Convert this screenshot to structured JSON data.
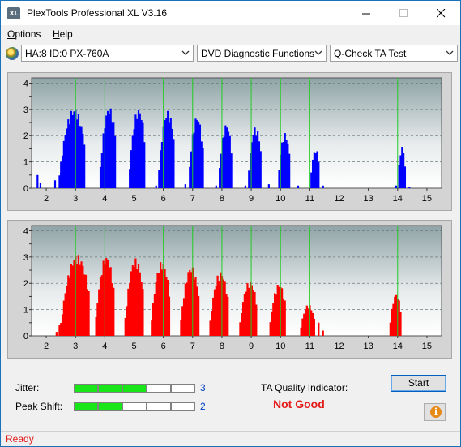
{
  "window": {
    "title": "PlexTools Professional XL V3.16",
    "app_icon_text": "XL"
  },
  "menu": {
    "options_label": "Options",
    "options_hotkey": "O",
    "options_rest": "ptions",
    "help_label": "Help",
    "help_hotkey": "H",
    "help_rest": "elp"
  },
  "toolbar": {
    "drive": "HA:8 ID:0  PX-760A",
    "function": "DVD Diagnostic Functions",
    "test": "Q-Check TA Test"
  },
  "colors": {
    "top_bars": "#0000ff",
    "bottom_bars": "#ff0000",
    "markers": "#22cc22",
    "meter_on": "#19e619",
    "status": "#e21b1b"
  },
  "chart_data": [
    {
      "type": "bar",
      "x_ticks": [
        2,
        3,
        4,
        5,
        6,
        7,
        8,
        9,
        10,
        11,
        12,
        13,
        14,
        15
      ],
      "y_ticks": [
        "0",
        "0.5",
        "1",
        "1.5",
        "2",
        "2.5",
        "3",
        "3.5",
        "4"
      ],
      "xlim": [
        1.5,
        15.5
      ],
      "ylim": [
        0,
        4.2
      ],
      "markers": [
        3,
        4,
        5,
        6,
        7,
        8,
        9,
        10,
        11,
        14
      ],
      "groups": [
        {
          "center": 2.95,
          "peak": 3.05,
          "half_width": 0.55
        },
        {
          "center": 4.15,
          "peak": 3.1,
          "half_width": 0.35
        },
        {
          "center": 5.15,
          "peak": 3.05,
          "half_width": 0.35
        },
        {
          "center": 6.15,
          "peak": 2.95,
          "half_width": 0.35
        },
        {
          "center": 7.15,
          "peak": 2.75,
          "half_width": 0.3
        },
        {
          "center": 8.15,
          "peak": 2.45,
          "half_width": 0.28
        },
        {
          "center": 9.15,
          "peak": 2.35,
          "half_width": 0.28
        },
        {
          "center": 10.15,
          "peak": 2.1,
          "half_width": 0.25
        },
        {
          "center": 11.2,
          "peak": 1.5,
          "half_width": 0.2
        },
        {
          "center": 14.15,
          "peak": 1.6,
          "half_width": 0.15
        }
      ],
      "noise_x": [
        1.7,
        1.8,
        2.3,
        2.5,
        5.75,
        6.75,
        7.8,
        8.8,
        9.6,
        10.6,
        11.45,
        13.95,
        14.4
      ],
      "noise_y": [
        0.5,
        0.2,
        0.3,
        0.6,
        0.1,
        0.15,
        0.1,
        0.1,
        0.15,
        0.1,
        0.1,
        0.1,
        0.05
      ]
    },
    {
      "type": "bar",
      "x_ticks": [
        2,
        3,
        4,
        5,
        6,
        7,
        8,
        9,
        10,
        11,
        12,
        13,
        14,
        15
      ],
      "y_ticks": [
        "0",
        "0.5",
        "1",
        "1.5",
        "2",
        "2.5",
        "3",
        "3.5",
        "4"
      ],
      "xlim": [
        1.5,
        15.5
      ],
      "ylim": [
        0,
        4.2
      ],
      "markers": [
        3,
        4,
        5,
        6,
        7,
        8,
        9,
        10,
        11,
        14
      ],
      "groups": [
        {
          "center": 3.05,
          "peak": 3.1,
          "half_width": 0.6
        },
        {
          "center": 4.05,
          "peak": 3.05,
          "half_width": 0.4
        },
        {
          "center": 5.05,
          "peak": 2.95,
          "half_width": 0.4
        },
        {
          "center": 5.95,
          "peak": 2.85,
          "half_width": 0.4
        },
        {
          "center": 6.95,
          "peak": 2.65,
          "half_width": 0.4
        },
        {
          "center": 7.95,
          "peak": 2.45,
          "half_width": 0.4
        },
        {
          "center": 8.95,
          "peak": 2.1,
          "half_width": 0.38
        },
        {
          "center": 9.95,
          "peak": 2.0,
          "half_width": 0.35
        },
        {
          "center": 10.95,
          "peak": 1.2,
          "half_width": 0.3
        },
        {
          "center": 13.95,
          "peak": 1.6,
          "half_width": 0.25
        }
      ],
      "noise_x": [
        2.35,
        2.45,
        11.3,
        11.45
      ],
      "noise_y": [
        0.15,
        0.4,
        0.5,
        0.2
      ]
    }
  ],
  "quality": {
    "jitter_label": "Jitter:",
    "jitter_value": "3",
    "jitter_level": 3,
    "peak_label": "Peak Shift:",
    "peak_value": "2",
    "peak_level": 2,
    "meter_max": 5,
    "ta_label": "TA Quality Indicator:",
    "ta_value": "Not Good",
    "start_label": "Start"
  },
  "status": {
    "text": "Ready"
  }
}
